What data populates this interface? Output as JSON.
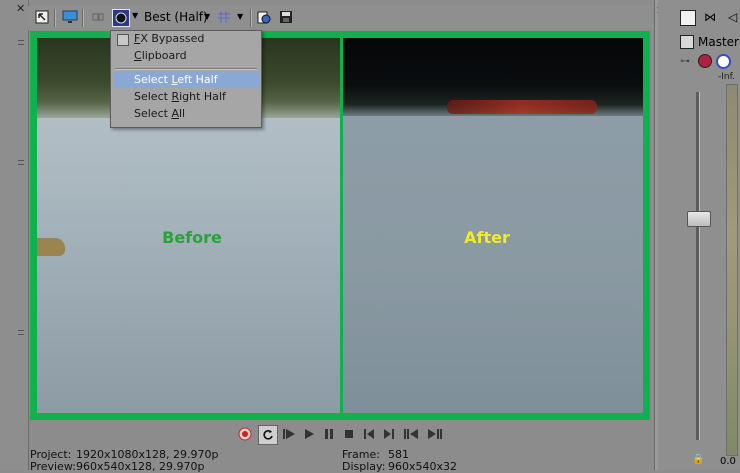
{
  "toolbar": {
    "quality": "Best (Half)"
  },
  "menu": {
    "items": [
      {
        "label": "FX Bypassed",
        "underline_index": 0
      },
      {
        "label": "Clipboard",
        "underline_index": 0
      },
      {
        "label": "Select Left Half",
        "underline_index": 7
      },
      {
        "label": "Select Right Half",
        "underline_index": 7
      },
      {
        "label": "Select All",
        "underline_index": 7
      }
    ],
    "selected": "Select Left Half"
  },
  "video": {
    "left_label": "Before",
    "right_label": "After",
    "left_label_color": "#2aa23a",
    "right_label_color": "#f2ea2a",
    "frame_color": "#0fb050"
  },
  "status": {
    "project_label": "Project:",
    "project_value": "1920x1080x128, 29.970p",
    "preview_label": "Preview:",
    "preview_value": "960x540x128, 29.970p",
    "frame_label": "Frame:",
    "frame_value": "581",
    "display_label": "Display:",
    "display_value": "960x540x32"
  },
  "right_panel": {
    "master_label": "Master",
    "meter_top_label": "-Inf.",
    "level_value": "0.0"
  },
  "icons": {
    "transport": [
      "record-icon",
      "loop-icon",
      "play-from-start-icon",
      "play-icon",
      "pause-icon",
      "stop-icon",
      "go-to-start-icon",
      "go-to-end-icon",
      "prev-frame-icon",
      "next-frame-icon"
    ]
  }
}
